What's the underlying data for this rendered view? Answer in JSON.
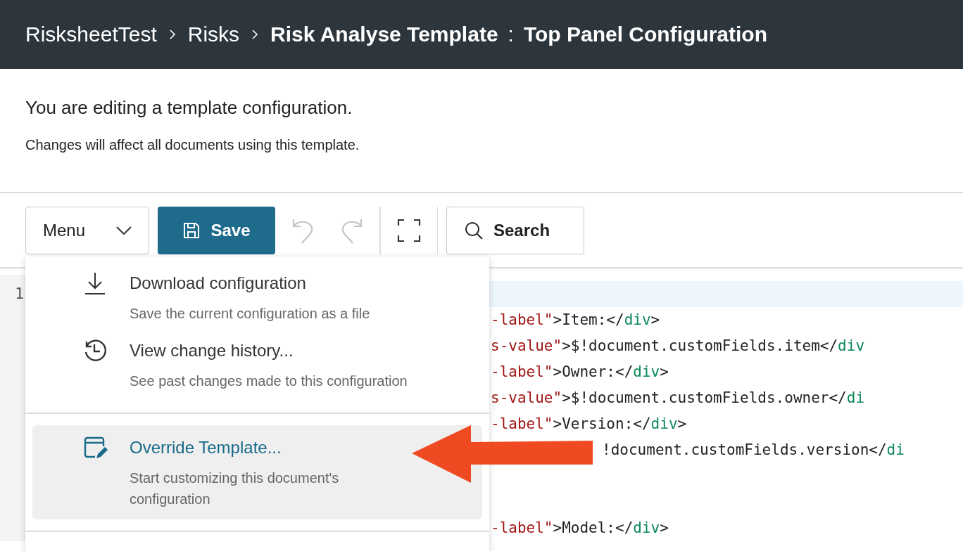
{
  "header": {
    "breadcrumb": [
      {
        "label": "RisksheetTest",
        "kind": "link"
      },
      {
        "label": "Risks",
        "kind": "link"
      },
      {
        "label": "Risk Analyse Template",
        "kind": "current"
      }
    ],
    "separator": ":",
    "page_title": "Top Panel Configuration"
  },
  "notice": {
    "title": "You are editing a template configuration.",
    "text": "Changes will affect all documents using this template."
  },
  "toolbar": {
    "menu_button": "Menu",
    "save_button": "Save",
    "undo": {
      "disabled": true
    },
    "redo": {
      "disabled": true
    },
    "search_button": "Search"
  },
  "editor": {
    "lines": [
      {
        "number": "1",
        "current": true
      },
      {
        "current": false,
        "tokens": [
          {
            "kind": "attr",
            "text": "-label\""
          },
          {
            "kind": "text",
            "text": ">Item:</"
          },
          {
            "kind": "tag",
            "text": "div"
          },
          {
            "kind": "text",
            "text": ">"
          }
        ]
      },
      {
        "current": false,
        "tokens": [
          {
            "kind": "attr",
            "text": "s-value\""
          },
          {
            "kind": "text",
            "text": ">$!document.customFields.item</"
          },
          {
            "kind": "tag",
            "text": "div"
          }
        ]
      },
      {
        "current": false,
        "tokens": [
          {
            "kind": "attr",
            "text": "-label\""
          },
          {
            "kind": "text",
            "text": ">Owner:</"
          },
          {
            "kind": "tag",
            "text": "div"
          },
          {
            "kind": "text",
            "text": ">"
          }
        ]
      },
      {
        "current": false,
        "tokens": [
          {
            "kind": "attr",
            "text": "s-value\""
          },
          {
            "kind": "text",
            "text": ">$!document.customFields.owner</"
          },
          {
            "kind": "tag",
            "text": "di"
          }
        ]
      },
      {
        "current": false,
        "tokens": [
          {
            "kind": "attr",
            "text": "-label\""
          },
          {
            "kind": "text",
            "text": ">Version:</"
          },
          {
            "kind": "tag",
            "text": "div"
          },
          {
            "kind": "text",
            "text": ">"
          }
        ]
      },
      {
        "current": false,
        "tokens": [
          {
            "kind": "text",
            "text": "!document.customFields.version</"
          },
          {
            "kind": "tag",
            "text": "di"
          }
        ]
      },
      {
        "current": false
      },
      {
        "current": false
      },
      {
        "current": false,
        "tokens": [
          {
            "kind": "attr",
            "text": "-label\""
          },
          {
            "kind": "text",
            "text": ">Model:</"
          },
          {
            "kind": "tag",
            "text": "div"
          },
          {
            "kind": "text",
            "text": ">"
          }
        ]
      }
    ]
  },
  "menu": {
    "items": [
      {
        "kind": "download",
        "title": "Download configuration",
        "description": "Save the current configuration as a file",
        "selected": false
      },
      {
        "kind": "history",
        "title": "View change history...",
        "description": "See past changes made to this configuration",
        "selected": false
      },
      {
        "kind": "override",
        "title": "Override Template...",
        "description": "Start customizing this document's configuration",
        "selected": true
      }
    ]
  }
}
